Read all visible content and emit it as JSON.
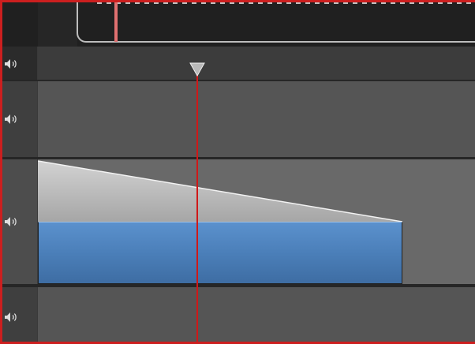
{
  "app": {
    "panel": "audio-timeline"
  },
  "colors": {
    "frame_border": "#cc1f1f",
    "ruler_bg": "#202020",
    "track_bg_light": "#555555",
    "track_bg_selected": "#696969",
    "clip_blue": "#4a80bd",
    "envelope_gray": "#b4b4b4",
    "playhead": "#d01818",
    "header_icon": "#dedede"
  },
  "ruler": {
    "marker": "playback-range-marker",
    "thumb": "horizontal-scroll-thumb"
  },
  "tracks": [
    {
      "id": "ruler-lane",
      "icon": "speaker-icon",
      "muted": false
    },
    {
      "id": "audio-1",
      "icon": "speaker-icon",
      "muted": false
    },
    {
      "id": "audio-2",
      "icon": "speaker-icon",
      "muted": false,
      "selected": true,
      "clip": {
        "color": "blue",
        "fade": "fade-out",
        "fade_from": 1.0,
        "fade_to": 0.0
      }
    },
    {
      "id": "audio-3",
      "icon": "speaker-icon",
      "muted": false
    }
  ],
  "playhead": {
    "icon": "playhead-triangle-icon"
  }
}
